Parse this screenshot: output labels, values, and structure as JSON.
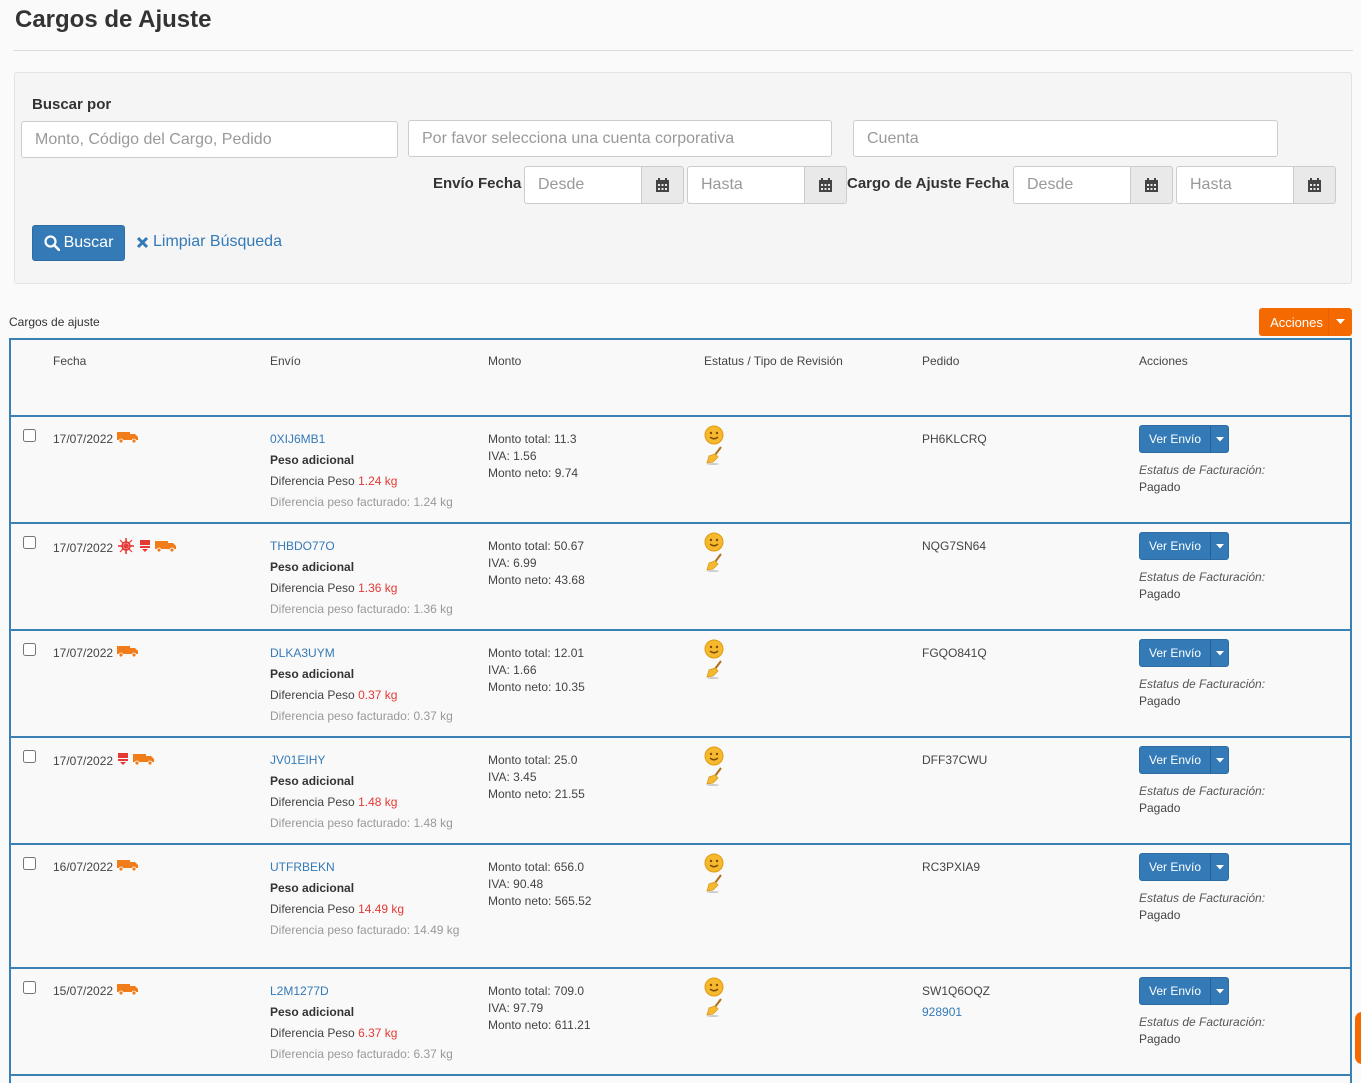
{
  "page": {
    "title": "Cargos de Ajuste"
  },
  "search": {
    "label": "Buscar por",
    "query_placeholder": "Monto, Código del Cargo, Pedido",
    "corporate_placeholder": "Por favor selecciona una cuenta corporativa",
    "account_placeholder": "Cuenta",
    "shipping_date_label": "Envío Fecha",
    "adjust_date_label": "Cargo de Ajuste Fecha",
    "from_placeholder": "Desde",
    "to_placeholder": "Hasta",
    "search_button": "Buscar",
    "clear_link": "Limpiar Búsqueda"
  },
  "table": {
    "caption": "Cargos de ajuste",
    "actions_button": "Acciones",
    "headers": [
      "Fecha",
      "Envío",
      "Monto",
      "Estatus / Tipo de Revisión",
      "Pedido",
      "Acciones"
    ],
    "row_labels": {
      "type": "Peso adicional",
      "diff_prefix": "Diferencia Peso",
      "billed_prefix": "Diferencia peso facturado:",
      "total_prefix": "Monto total:",
      "iva_prefix": "IVA:",
      "neto_prefix": "Monto neto:",
      "view_button": "Ver Envío",
      "billing_label": "Estatus de Facturación:"
    },
    "rows": [
      {
        "date": "17/07/2022",
        "icons": [
          "truck-icon"
        ],
        "shipment": "0XIJ6MB1",
        "diff": "1.24 kg",
        "billed": "1.24 kg",
        "total": "11.3",
        "iva": "1.56",
        "neto": "9.74",
        "order": "PH6KLCRQ",
        "order_link": "",
        "billing": "Pagado"
      },
      {
        "date": "17/07/2022",
        "icons": [
          "bug-icon",
          "flag-icon",
          "truck-icon"
        ],
        "shipment": "THBDO77O",
        "diff": "1.36 kg",
        "billed": "1.36 kg",
        "total": "50.67",
        "iva": "6.99",
        "neto": "43.68",
        "order": "NQG7SN64",
        "order_link": "",
        "billing": "Pagado"
      },
      {
        "date": "17/07/2022",
        "icons": [
          "truck-icon"
        ],
        "shipment": "DLKA3UYM",
        "diff": "0.37 kg",
        "billed": "0.37 kg",
        "total": "12.01",
        "iva": "1.66",
        "neto": "10.35",
        "order": "FGQO841Q",
        "order_link": "",
        "billing": "Pagado"
      },
      {
        "date": "17/07/2022",
        "icons": [
          "flag-icon",
          "truck-icon"
        ],
        "shipment": "JV01EIHY",
        "diff": "1.48 kg",
        "billed": "1.48 kg",
        "total": "25.0",
        "iva": "3.45",
        "neto": "21.55",
        "order": "DFF37CWU",
        "order_link": "",
        "billing": "Pagado"
      },
      {
        "date": "16/07/2022",
        "icons": [
          "truck-icon"
        ],
        "shipment": "UTFRBEKN",
        "diff": "14.49 kg",
        "billed": "14.49 kg",
        "total": "656.0",
        "iva": "90.48",
        "neto": "565.52",
        "order": "RC3PXIA9",
        "order_link": "",
        "billing": "Pagado"
      },
      {
        "date": "15/07/2022",
        "icons": [
          "truck-icon"
        ],
        "shipment": "L2M1277D",
        "diff": "6.37 kg",
        "billed": "6.37 kg",
        "total": "709.0",
        "iva": "97.79",
        "neto": "611.21",
        "order": "SW1Q6OQZ",
        "order_link": "928901",
        "billing": "Pagado"
      }
    ]
  },
  "colors": {
    "primary": "#337ab7",
    "accent": "#f56a00",
    "danger": "#e53935",
    "border": "#3b80b4"
  }
}
